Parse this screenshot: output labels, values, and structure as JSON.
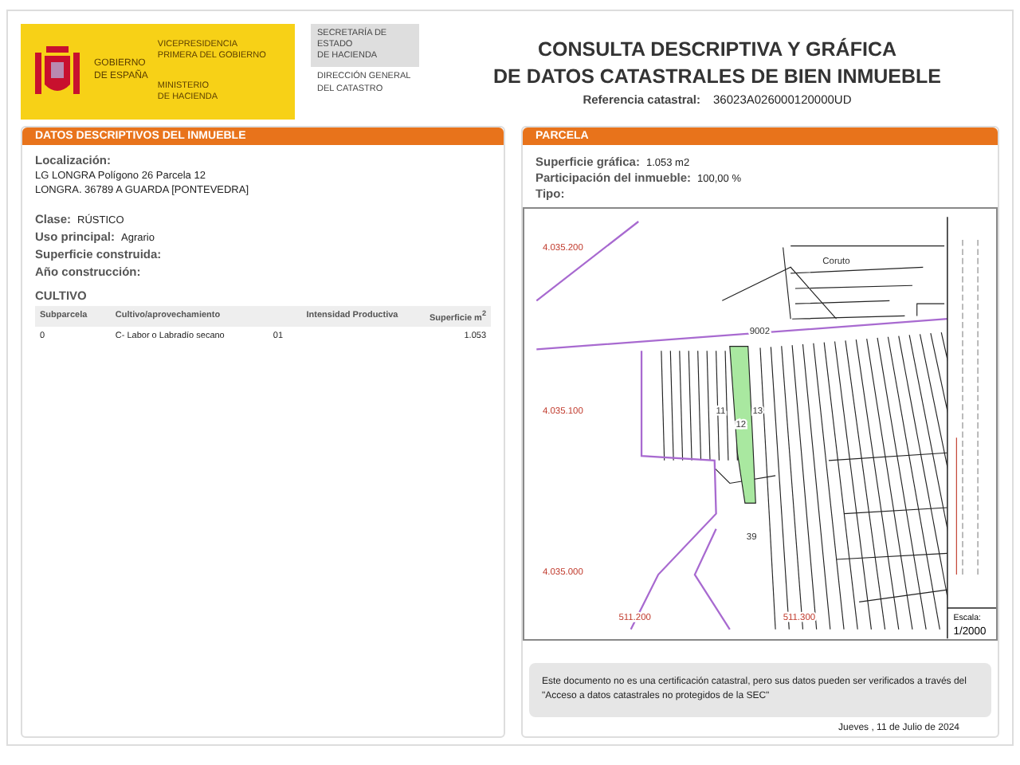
{
  "header": {
    "government": "GOBIERNO\nDE ESPAÑA",
    "vice": "VICEPRESIDENCIA\nPRIMERA DEL GOBIERNO",
    "ministry": "MINISTERIO\nDE HACIENDA",
    "secretary": "SECRETARÍA DE ESTADO\nDE HACIENDA",
    "directorate": "DIRECCIÓN GENERAL\nDEL CATASTRO",
    "title": "CONSULTA DESCRIPTIVA Y GRÁFICA\nDE DATOS CATASTRALES DE BIEN INMUEBLE",
    "reference_label": "Referencia catastral:",
    "reference_value": "36023A026000120000UD"
  },
  "left_panel": {
    "title": "DATOS DESCRIPTIVOS DEL INMUEBLE",
    "location_label": "Localización:",
    "location_lines": [
      "LG LONGRA  Polígono 26 Parcela 12",
      "LONGRA. 36789 A GUARDA [PONTEVEDRA]"
    ],
    "fields": [
      {
        "label": "Clase:",
        "value": "RÚSTICO"
      },
      {
        "label": "Uso principal:",
        "value": "Agrario"
      },
      {
        "label": "Superficie construida:"
      },
      {
        "label": "Año construcción:"
      }
    ],
    "cultivo": {
      "title": "CULTIVO",
      "columns": [
        "Subparcela",
        "Cultivo/aprovechamiento",
        "Intensidad Productiva",
        "Superficie m$^{2}$"
      ],
      "rows": [
        [
          "0",
          "C- Labor o Labradío secano",
          "01",
          "1.053"
        ]
      ]
    }
  },
  "right_panel": {
    "title": "PARCELA",
    "fields": [
      {
        "label": "Superficie gráfica:",
        "value": "1.053 m2"
      },
      {
        "label": "Participación del inmueble:",
        "value": "100,00 %"
      },
      {
        "label": "Tipo:"
      }
    ],
    "map": {
      "labels": [
        {
          "kind": "coordinate",
          "text": "4.035.200"
        },
        {
          "kind": "coordinate",
          "text": "4.035.100"
        },
        {
          "kind": "coordinate",
          "text": "4.035.000"
        },
        {
          "kind": "coordinate",
          "text": "511.200"
        },
        {
          "kind": "coordinate",
          "text": "511.300"
        },
        {
          "kind": "place",
          "text": "Coruto"
        },
        {
          "kind": "place",
          "text": "9002"
        },
        {
          "kind": "place",
          "text": "11"
        },
        {
          "kind": "place",
          "text": "12"
        },
        {
          "kind": "place",
          "text": "13"
        },
        {
          "kind": "place",
          "text": "39"
        }
      ],
      "scale_label": "Escala:",
      "scale_value": "1/2000"
    },
    "note": "Este documento no es una certificación catastral, pero sus datos pueden ser verificados a través del \"Acceso a datos catastrales no protegidos de la SEC\"",
    "date": "Jueves , 11 de Julio de 2024"
  }
}
